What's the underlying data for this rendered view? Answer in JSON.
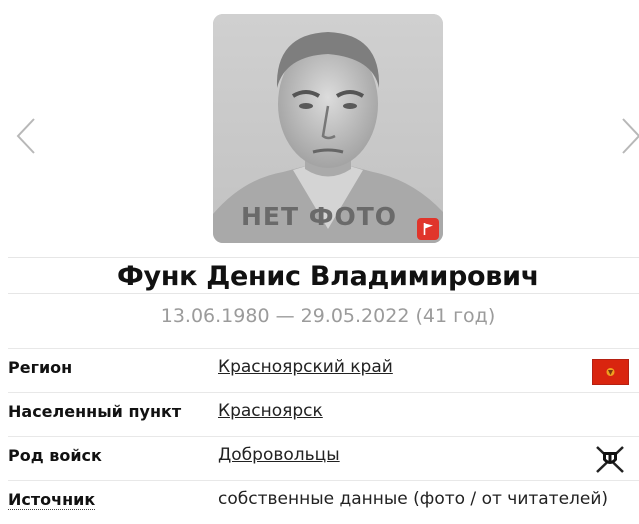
{
  "photo": {
    "placeholder_text": "НЕТ ФОТО",
    "flag_button_icon": "flag-icon"
  },
  "navigation": {
    "prev_icon": "chevron-left-icon",
    "next_icon": "chevron-right-icon"
  },
  "person": {
    "name": "Функ Денис Владимирович",
    "dates": "13.06.1980 — 29.05.2022 (41 год)"
  },
  "details": [
    {
      "label": "Регион",
      "value": "Красноярский край",
      "icon": "region-flag-icon"
    },
    {
      "label": "Населенный пункт",
      "value": "Красноярск"
    },
    {
      "label": "Род войск",
      "value": "Добровольцы",
      "icon": "crossed-swords-icon"
    },
    {
      "label": "Источник",
      "value": "собственные данные (фото / от читателей)"
    }
  ],
  "colors": {
    "accent_red": "#e0352b",
    "muted_text": "#9b9b9b",
    "photo_bg": "#c9c9c9"
  }
}
